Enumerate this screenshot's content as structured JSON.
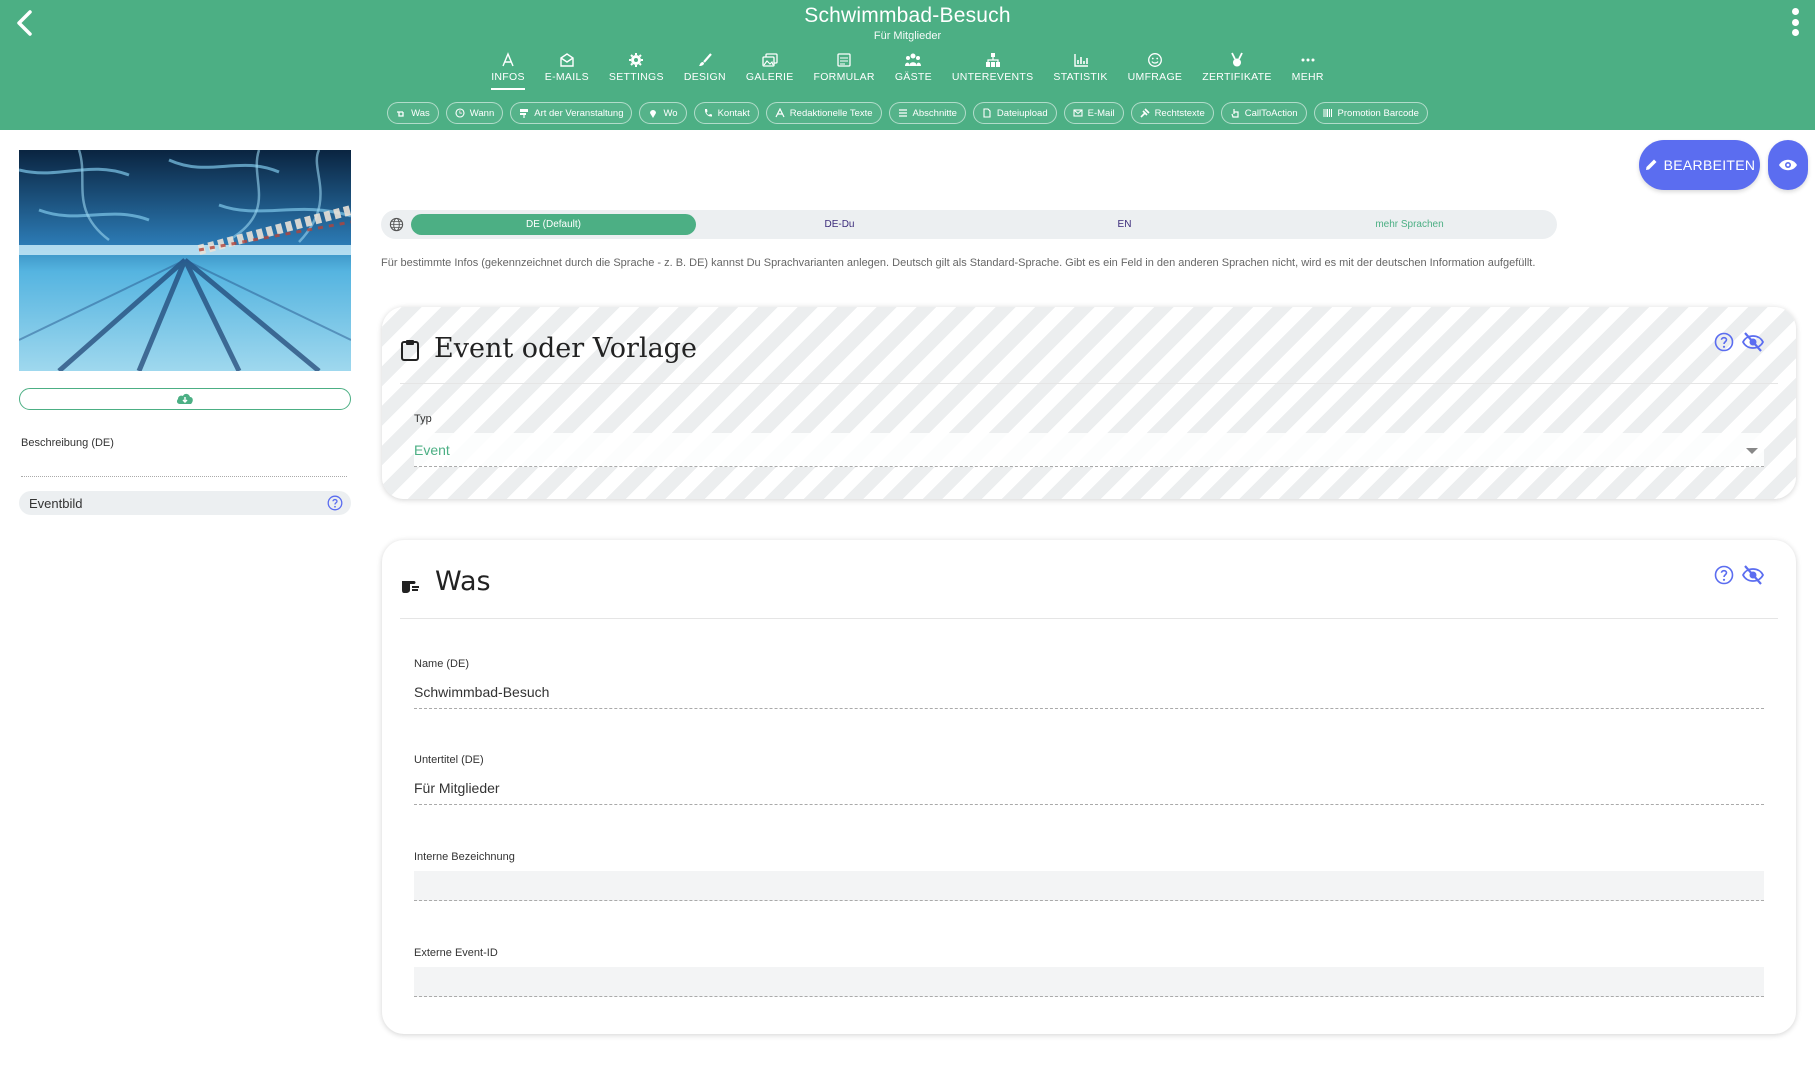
{
  "header": {
    "title": "Schwimmbad-Besuch",
    "subtitle": "Für Mitglieder",
    "tabs": [
      {
        "label": "INFOS",
        "icon": "font-icon"
      },
      {
        "label": "E-MAILS",
        "icon": "envelope-open-icon"
      },
      {
        "label": "SETTINGS",
        "icon": "gear-icon"
      },
      {
        "label": "DESIGN",
        "icon": "brush-icon"
      },
      {
        "label": "GALERIE",
        "icon": "images-icon"
      },
      {
        "label": "FORMULAR",
        "icon": "form-icon"
      },
      {
        "label": "GÄSTE",
        "icon": "users-icon"
      },
      {
        "label": "UNTEREVENTS",
        "icon": "sitemap-icon"
      },
      {
        "label": "STATISTIK",
        "icon": "chart-icon"
      },
      {
        "label": "UMFRAGE",
        "icon": "smile-icon"
      },
      {
        "label": "ZERTIFIKATE",
        "icon": "medal-icon"
      },
      {
        "label": "MEHR",
        "icon": "more-icon"
      }
    ]
  },
  "chips": [
    {
      "label": "Was"
    },
    {
      "label": "Wann"
    },
    {
      "label": "Art der Veranstaltung"
    },
    {
      "label": "Wo"
    },
    {
      "label": "Kontakt"
    },
    {
      "label": "Redaktionelle Texte"
    },
    {
      "label": "Abschnitte"
    },
    {
      "label": "Dateiupload"
    },
    {
      "label": "E-Mail"
    },
    {
      "label": "Rechtstexte"
    },
    {
      "label": "CallToAction"
    },
    {
      "label": "Promotion Barcode"
    }
  ],
  "sidebar": {
    "description_label": "Beschreibung (DE)",
    "eventbild_label": "Eventbild"
  },
  "actions": {
    "edit_label": "BEARBEITEN"
  },
  "languages": {
    "tabs": [
      "DE (Default)",
      "DE-Du",
      "EN",
      "mehr Sprachen"
    ],
    "info": "Für bestimmte Infos (gekennzeichnet durch die Sprache - z. B. DE) kannst Du Sprachvarianten anlegen. Deutsch gilt als Standard-Sprache. Gibt es ein Feld in den anderen Sprachen nicht, wird es mit der deutschen Information aufgefüllt."
  },
  "card_event": {
    "title": "Event oder Vorlage",
    "type_label": "Typ",
    "type_value": "Event"
  },
  "card_was": {
    "title": "Was",
    "name_label": "Name (DE)",
    "name_value": "Schwimmbad-Besuch",
    "subtitle_label": "Untertitel (DE)",
    "subtitle_value": "Für Mitglieder",
    "internal_label": "Interne Bezeichnung",
    "internal_value": "",
    "external_label": "Externe Event-ID",
    "external_value": ""
  },
  "colors": {
    "brand_green": "#4caf84",
    "accent_blue": "#5b6df0"
  }
}
